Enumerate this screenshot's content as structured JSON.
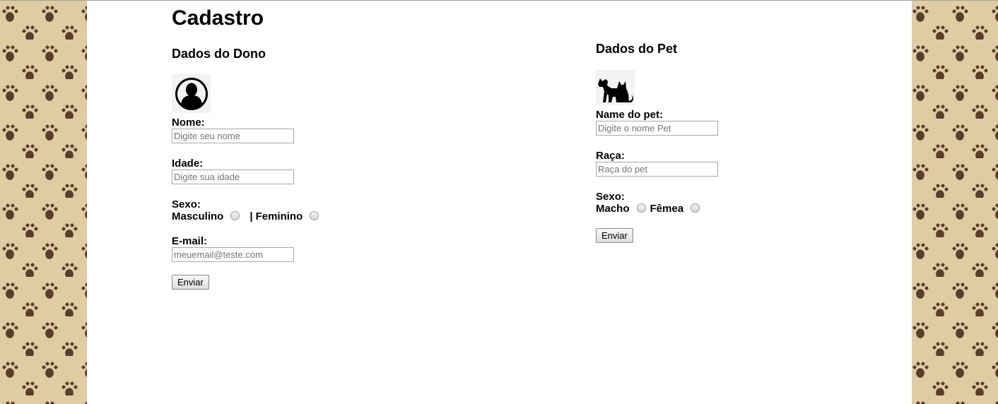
{
  "page": {
    "title": "Cadastro",
    "background_color": "#dfcca3",
    "paw_color": "#5a3d2b",
    "content_color": "#ffffff"
  },
  "owner": {
    "heading": "Dados do Dono",
    "photo_icon": "person-silhouette-icon",
    "name": {
      "label": "Nome:",
      "placeholder": "Digite seu nome"
    },
    "age": {
      "label": "Idade:",
      "placeholder": "Digite sua idade"
    },
    "sex": {
      "label": "Sexo:",
      "option_male": "Masculino",
      "separator": "|",
      "option_female": "Feminino"
    },
    "email": {
      "label": "E-mail:",
      "placeholder": "meuemail@teste.com"
    },
    "submit_label": "Enviar"
  },
  "pet": {
    "heading": "Dados do Pet",
    "photo_icon": "dog-and-cat-icon",
    "name": {
      "label": "Name do pet:",
      "placeholder": "Digite o nome Pet"
    },
    "breed": {
      "label": "Raça:",
      "placeholder": "Raça do pet"
    },
    "sex": {
      "label": "Sexo:",
      "option_male": "Macho",
      "option_female": "Fêmea"
    },
    "submit_label": "Enviar"
  }
}
